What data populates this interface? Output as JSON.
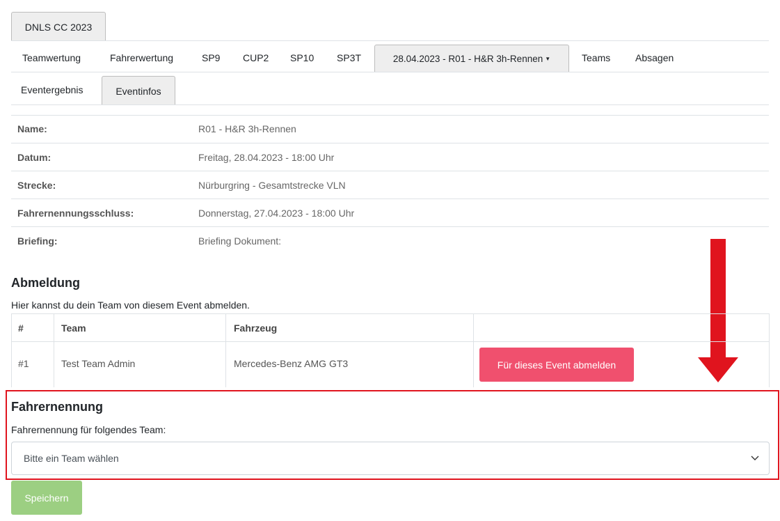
{
  "top_tab": "DNLS CC 2023",
  "nav": {
    "items": [
      "Teamwertung",
      "Fahrerwertung",
      "SP9",
      "CUP2",
      "SP10",
      "SP3T"
    ],
    "event_dropdown": "28.04.2023 - R01 - H&R 3h-Rennen",
    "after": [
      "Teams",
      "Absagen"
    ]
  },
  "subnav": {
    "eventergebnis": "Eventergebnis",
    "eventinfos": "Eventinfos"
  },
  "info": [
    {
      "label": "Name:",
      "value": "R01 - H&R 3h-Rennen"
    },
    {
      "label": "Datum:",
      "value": "Freitag, 28.04.2023 - 18:00 Uhr"
    },
    {
      "label": "Strecke:",
      "value": "Nürburgring - Gesamtstrecke VLN"
    },
    {
      "label": "Fahrernennungsschluss:",
      "value": "Donnerstag, 27.04.2023 - 18:00 Uhr"
    },
    {
      "label": "Briefing:",
      "value": "Briefing Dokument:"
    }
  ],
  "abmeldung": {
    "title": "Abmeldung",
    "text": "Hier kannst du dein Team von diesem Event abmelden.",
    "headers": [
      "#",
      "Team",
      "Fahrzeug"
    ],
    "row": {
      "num": "#1",
      "team": "Test Team Admin",
      "car": "Mercedes-Benz AMG GT3"
    },
    "button": "Für dieses Event abmelden"
  },
  "fahrernennung": {
    "title": "Fahrernennung",
    "label": "Fahrernennung für folgendes Team:",
    "select": "Bitte ein Team wählen"
  },
  "save_button": "Speichern",
  "colors": {
    "danger": "#f0506e",
    "success": "#9ccf82",
    "highlight": "#e0141e"
  }
}
